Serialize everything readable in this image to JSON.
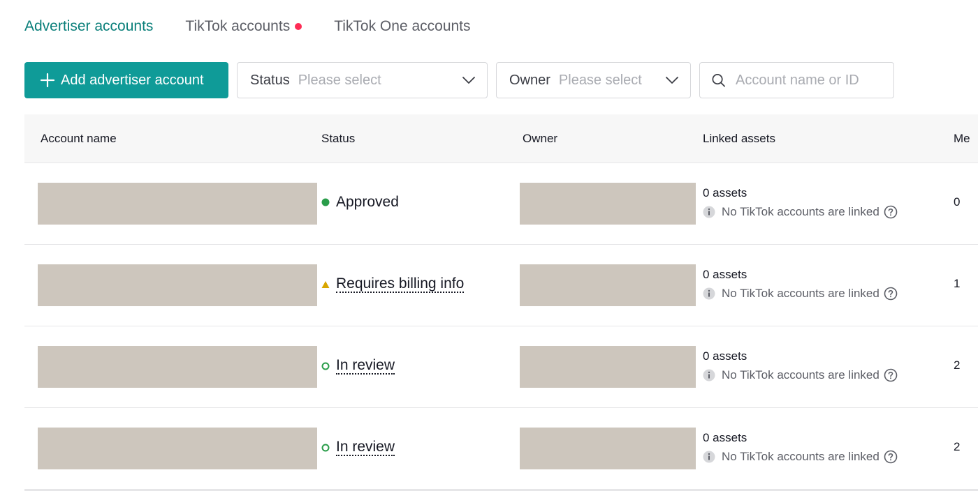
{
  "tabs": [
    {
      "label": "Advertiser accounts",
      "active": true,
      "badge": false
    },
    {
      "label": "TikTok accounts",
      "active": false,
      "badge": true
    },
    {
      "label": "TikTok One accounts",
      "active": false,
      "badge": false
    }
  ],
  "toolbar": {
    "add_label": "Add advertiser account",
    "status_label": "Status",
    "status_placeholder": "Please select",
    "owner_label": "Owner",
    "owner_placeholder": "Please select",
    "search_placeholder": "Account name or ID"
  },
  "table": {
    "headers": [
      "Account name",
      "Status",
      "Owner",
      "Linked assets",
      "Me"
    ],
    "rows": [
      {
        "status": "Approved",
        "status_type": "approved",
        "assets": "0 assets",
        "linked_note": "No TikTok accounts are linked",
        "members": "0"
      },
      {
        "status": "Requires billing info",
        "status_type": "warning",
        "assets": "0 assets",
        "linked_note": "No TikTok accounts are linked",
        "members": "1"
      },
      {
        "status": "In review",
        "status_type": "review",
        "assets": "0 assets",
        "linked_note": "No TikTok accounts are linked",
        "members": "2"
      },
      {
        "status": "In review",
        "status_type": "review",
        "assets": "0 assets",
        "linked_note": "No TikTok accounts are linked",
        "members": "2"
      }
    ]
  },
  "colors": {
    "accent": "#0f9b98",
    "active_tab": "#0a7f7a",
    "badge": "#fe2c55",
    "approved": "#2a9d4a",
    "warning": "#d8a600",
    "redaction": "#cdc6bd"
  },
  "icons": {
    "plus": "plus-icon",
    "chevron": "chevron-down-icon",
    "search": "search-icon",
    "info": "info-icon",
    "help": "help-icon"
  }
}
